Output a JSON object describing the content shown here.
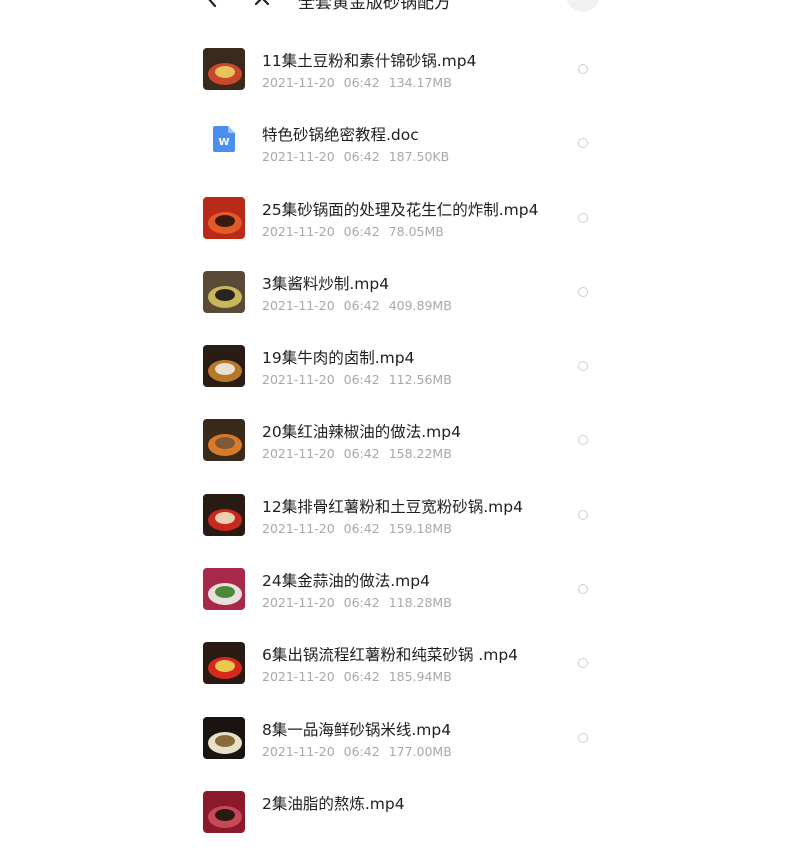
{
  "header": {
    "title": "全套黄金版砂锅配方"
  },
  "files": [
    {
      "name": "11集土豆粉和素什锦砂锅.mp4",
      "date": "2021-11-20",
      "time": "06:42",
      "size": "134.17MB",
      "type": "video",
      "thumb_colors": [
        "#3a2a1e",
        "#c9482c",
        "#e8c25a"
      ]
    },
    {
      "name": "特色砂锅绝密教程.doc",
      "date": "2021-11-20",
      "time": "06:42",
      "size": "187.50KB",
      "type": "doc",
      "thumb_colors": [
        "#4a8ef0",
        "#ffffff"
      ]
    },
    {
      "name": "25集砂锅面的处理及花生仁的炸制.mp4",
      "date": "2021-11-20",
      "time": "06:42",
      "size": "78.05MB",
      "type": "video",
      "thumb_colors": [
        "#b92a18",
        "#e05a2a",
        "#3a1a10"
      ]
    },
    {
      "name": "3集酱料炒制.mp4",
      "date": "2021-11-20",
      "time": "06:42",
      "size": "409.89MB",
      "type": "video",
      "thumb_colors": [
        "#5a4a38",
        "#c8b85a",
        "#2a2420"
      ]
    },
    {
      "name": "19集牛肉的卤制.mp4",
      "date": "2021-11-20",
      "time": "06:42",
      "size": "112.56MB",
      "type": "video",
      "thumb_colors": [
        "#2a1c14",
        "#b8782a",
        "#e8e0d0"
      ]
    },
    {
      "name": "20集红油辣椒油的做法.mp4",
      "date": "2021-11-20",
      "time": "06:42",
      "size": "158.22MB",
      "type": "video",
      "thumb_colors": [
        "#3a2a1a",
        "#d87a2a",
        "#7a5a3a"
      ]
    },
    {
      "name": "12集排骨红薯粉和土豆宽粉砂锅.mp4",
      "date": "2021-11-20",
      "time": "06:42",
      "size": "159.18MB",
      "type": "video",
      "thumb_colors": [
        "#2a1a14",
        "#c8281e",
        "#e8d0b0"
      ]
    },
    {
      "name": "24集金蒜油的做法.mp4",
      "date": "2021-11-20",
      "time": "06:42",
      "size": "118.28MB",
      "type": "video",
      "thumb_colors": [
        "#a8284a",
        "#e8e0e0",
        "#4a8a3a"
      ]
    },
    {
      "name": "6集出锅流程红薯粉和纯菜砂锅 .mp4",
      "date": "2021-11-20",
      "time": "06:42",
      "size": "185.94MB",
      "type": "video",
      "thumb_colors": [
        "#2a1a14",
        "#d8281e",
        "#e8c850"
      ]
    },
    {
      "name": "8集一品海鲜砂锅米线.mp4",
      "date": "2021-11-20",
      "time": "06:42",
      "size": "177.00MB",
      "type": "video",
      "thumb_colors": [
        "#1a1410",
        "#e8e0c8",
        "#8a6a3a"
      ]
    },
    {
      "name": "2集油脂的熬炼.mp4",
      "date": "",
      "time": "",
      "size": "",
      "type": "video",
      "thumb_colors": [
        "#8a1a2a",
        "#c8485a",
        "#2a1a14"
      ]
    }
  ]
}
